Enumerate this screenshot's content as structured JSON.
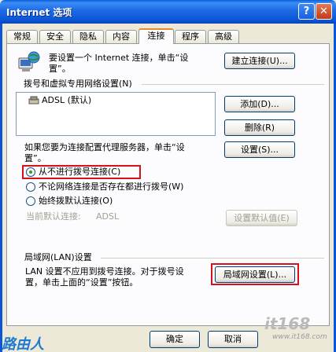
{
  "window": {
    "title": "Internet 选项",
    "help_glyph": "?",
    "close_glyph": "✕"
  },
  "tabs": [
    {
      "label": "常规"
    },
    {
      "label": "安全"
    },
    {
      "label": "隐私"
    },
    {
      "label": "内容"
    },
    {
      "label": "连接",
      "active": true
    },
    {
      "label": "程序"
    },
    {
      "label": "高级"
    }
  ],
  "setup": {
    "text_line1": "要设置一个 Internet 连接，单击“设",
    "text_line2": "置”。",
    "button": "建立连接(U)..."
  },
  "dialup": {
    "group_label": "拨号和虚拟专用网络设置(N)",
    "items": [
      {
        "label": "ADSL (默认)"
      }
    ],
    "add_button": "添加(D)...",
    "remove_button": "删除(R)",
    "proxy_text_line1": "如果您要为连接配置代理服务器，单击“设",
    "proxy_text_line2": "置”。",
    "settings_button": "设置(S)...",
    "radio_never": "从不进行拨号连接(C)",
    "radio_no_network": "不论网络连接是否存在都进行拨号(W)",
    "radio_always": "始终拨默认连接(O)",
    "current_default_label": "当前默认连接:",
    "current_default_value": "ADSL",
    "set_default_button": "设置默认值(E)"
  },
  "lan": {
    "group_label": "局域网(LAN)设置",
    "text_line1": "LAN 设置不应用到拨号连接。对于拨号设",
    "text_line2": "置，单击上面的“设置”按钮。",
    "button": "局域网设置(L)..."
  },
  "footer": {
    "ok_button": "确定",
    "cancel_button": "取消"
  },
  "watermarks": {
    "left": "路由人",
    "right_logo": "it168",
    "right_site": "www.it168.com"
  },
  "colors": {
    "title_bar": "#0b56d6",
    "face": "#ece9d8",
    "panel": "#fcfcfe",
    "highlight_box": "#d8101a",
    "active_tab_accent": "#e68b2c"
  }
}
